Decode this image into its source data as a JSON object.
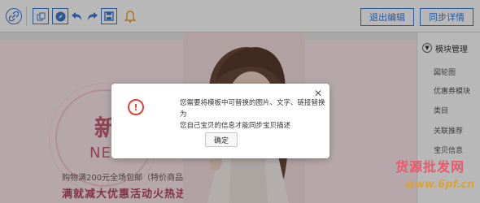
{
  "toolbar": {
    "exit_edit_label": "退出编辑",
    "sync_details_label": "同步详情",
    "icons": [
      "link-icon",
      "copy-icon",
      "compass-icon",
      "undo-icon",
      "redo-icon",
      "save-icon",
      "bell-icon"
    ]
  },
  "banner": {
    "headline": "新品",
    "headline_en": "NEW",
    "line1": "购物满200元全场包邮（特价商品除外）",
    "line2": "满就减大优惠活动火热进行中"
  },
  "sidebar": {
    "title": "模块管理",
    "items": [
      "図轮图",
      "优惠券模块",
      "类目",
      "关联推荐",
      "宝贝信息"
    ]
  },
  "dialog": {
    "message_line1": "您需要将模板中可替换的图片、文字、链接替换为",
    "message_line2": "您自己宝贝的信息才能同步宝贝描述",
    "ok_label": "确定"
  },
  "watermark": {
    "text_cn": "货源批发网",
    "text_url": "www.6pf.cn"
  },
  "colors": {
    "accent": "#3a7bd5",
    "alert": "#e1413b",
    "bell": "#f0a22e",
    "banner_bg": "#fbe8ec"
  }
}
